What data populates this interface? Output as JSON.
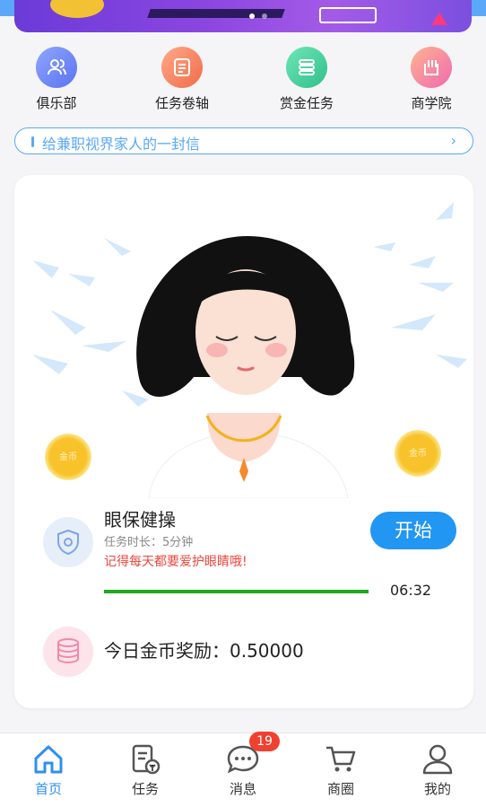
{
  "banner": {
    "pagination": [
      "active",
      "inactive"
    ]
  },
  "quick_menu": [
    {
      "label": "俱乐部",
      "icon": "people-icon",
      "color": "#6f86f5"
    },
    {
      "label": "任务卷轴",
      "icon": "scroll-icon",
      "color": "#f5845a"
    },
    {
      "label": "赏金任务",
      "icon": "list-icon",
      "color": "#3ecf9a"
    },
    {
      "label": "商学院",
      "icon": "book-icon",
      "color": "#f37fb0"
    }
  ],
  "notice": {
    "text": "给兼职视界家人的一封信",
    "chevron": "›"
  },
  "task": {
    "title": "眼保健操",
    "duration": "任务时长：5分钟",
    "tip": "记得每天都要爱护眼睛哦!",
    "button": "开始",
    "timer": "06:32",
    "progress": 1.0,
    "coin_label": "金币"
  },
  "reward": {
    "label": "今日金币奖励：0.50000"
  },
  "tabbar": {
    "home": "首页",
    "tasks": "任务",
    "messages": "消息",
    "messages_badge": "19",
    "shop": "商圈",
    "mine": "我的"
  },
  "colors": {
    "accent": "#2f8ef0",
    "start_button": "#2196f3",
    "tip": "#f0443a",
    "progress": "#1ea91e",
    "badge": "#f0402f"
  }
}
